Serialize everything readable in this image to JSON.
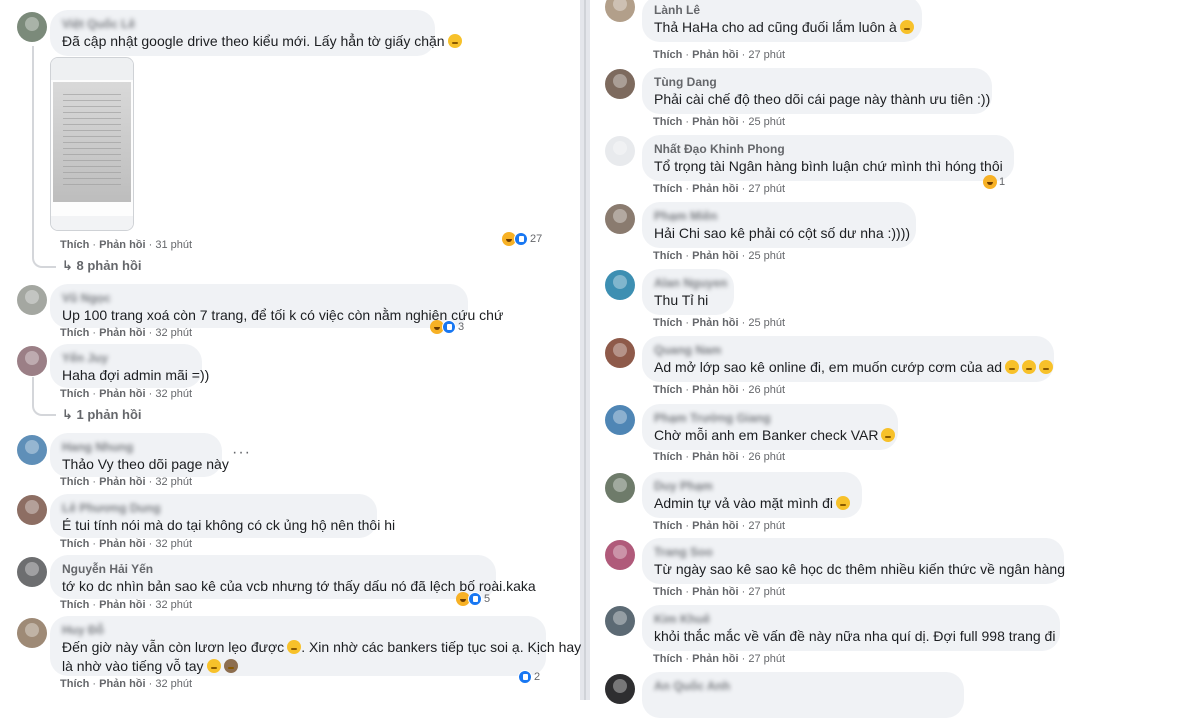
{
  "left": {
    "comments": [
      {
        "name": "Việt Quốc Lê",
        "text": "Đã cập nhật google drive theo kiểu mới. Lấy hẳn tờ giấy chặn",
        "like": "Thích",
        "reply": "Phản hồi",
        "time": "31 phút",
        "react_count": "27",
        "replies": "8 phản hồi"
      },
      {
        "name": "Vũ Ngọc",
        "text": "Up 100 trang xoá còn 7 trang, để tối k có việc còn nằm nghiên cứu chứ",
        "like": "Thích",
        "reply": "Phản hồi",
        "time": "32 phút",
        "react_count": "3"
      },
      {
        "name": "Yến Juy",
        "text": "Haha đợi admin mãi =))",
        "like": "Thích",
        "reply": "Phản hồi",
        "time": "32 phút",
        "replies": "1 phản hồi"
      },
      {
        "name": "Hang Nhung",
        "text": "Thảo Vy theo dõi page này",
        "like": "Thích",
        "reply": "Phản hồi",
        "time": "32 phút",
        "more": "···"
      },
      {
        "name": "Lê Phương Dung",
        "text": "É tui tính nói mà do tại không có ck ủng hộ nên thôi hi",
        "like": "Thích",
        "reply": "Phản hồi",
        "time": "32 phút"
      },
      {
        "name": "Nguyễn Hải Yến",
        "text": "tớ ko dc nhìn bản sao kê của vcb nhưng tớ thấy dấu nó đã lệch bố roài.kaka",
        "like": "Thích",
        "reply": "Phản hồi",
        "time": "32 phút",
        "react_count": "5"
      },
      {
        "name": "Huy Đỗ",
        "text": "Đến giờ này vẫn còn lươn lẹo được",
        "text2": "là nhờ vào tiếng vỗ tay",
        "text_b": ". Xin nhờ các bankers tiếp tục soi ạ. Kịch hay",
        "like": "Thích",
        "reply": "Phản hồi",
        "time": "32 phút",
        "react_count": "2"
      }
    ]
  },
  "right": {
    "comments": [
      {
        "name": "Lành Lê",
        "text": "Thả HaHa cho ad cũng đuối lắm luôn à",
        "like": "Thích",
        "reply": "Phản hồi",
        "time": "27 phút"
      },
      {
        "name": "Tùng Dang",
        "text": "Phải cài chế độ theo dõi cái page này thành ưu tiên :))",
        "like": "Thích",
        "reply": "Phản hồi",
        "time": "25 phút"
      },
      {
        "name": "Nhất Đạo Khinh Phong",
        "text": "Tổ trọng tài Ngân hàng bình luận chứ mình thì hóng thôi",
        "like": "Thích",
        "reply": "Phản hồi",
        "time": "27 phút",
        "react_count": "1"
      },
      {
        "name": "Phạm Miên",
        "text": "Hải Chi sao kê phải có cột số dư nha :))))",
        "like": "Thích",
        "reply": "Phản hồi",
        "time": "25 phút"
      },
      {
        "name": "Alan Nguyen",
        "text": "Thu Tỉ hi",
        "like": "Thích",
        "reply": "Phản hồi",
        "time": "25 phút"
      },
      {
        "name": "Quang Nam",
        "text": "Ad mở lớp sao kê online đi, em muốn cướp cơm của ad",
        "like": "Thích",
        "reply": "Phản hồi",
        "time": "26 phút"
      },
      {
        "name": "Phạm Trường Giang",
        "text": "Chờ mỗi anh em Banker check VAR",
        "like": "Thích",
        "reply": "Phản hồi",
        "time": "26 phút"
      },
      {
        "name": "Duy Phạm",
        "text": "Admin tự vả vào mặt mình đi",
        "like": "Thích",
        "reply": "Phản hồi",
        "time": "27 phút"
      },
      {
        "name": "Trang Soo",
        "text": "Từ ngày sao kê sao kê học dc thêm nhiều kiến thức về ngân hàng",
        "like": "Thích",
        "reply": "Phản hồi",
        "time": "27 phút"
      },
      {
        "name": "Kim Khuê",
        "text": "khỏi thắc mắc về vấn đề này nữa nha quí dị. Đợi full 998 trang đi",
        "like": "Thích",
        "reply": "Phản hồi",
        "time": "27 phút"
      },
      {
        "name": "An Quốc Anh",
        "text": "",
        "like": "",
        "reply": "",
        "time": ""
      }
    ]
  }
}
